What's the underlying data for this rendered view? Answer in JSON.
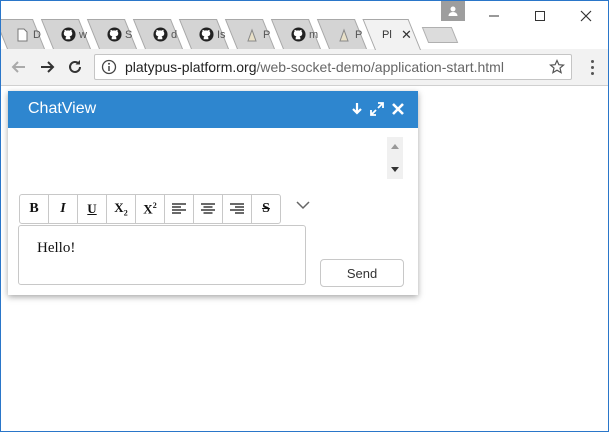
{
  "browser": {
    "tabs": [
      {
        "title": "D",
        "icon": "document-icon"
      },
      {
        "title": "w",
        "icon": "github-icon"
      },
      {
        "title": "S",
        "icon": "github-icon"
      },
      {
        "title": "d",
        "icon": "github-icon"
      },
      {
        "title": "Is",
        "icon": "github-icon"
      },
      {
        "title": "P",
        "icon": "page-icon"
      },
      {
        "title": "m",
        "icon": "github-icon"
      },
      {
        "title": "P",
        "icon": "page-icon"
      },
      {
        "title": "Pl",
        "icon": "none",
        "active": true
      }
    ],
    "url_host": "platypus-platform.org",
    "url_path": "/web-socket-demo/application-start.html",
    "close_glyph": "✕"
  },
  "chat": {
    "title": "ChatView",
    "editor_text": "Hello!",
    "send_label": "Send",
    "accent_color": "#2e86cf",
    "format_buttons": [
      {
        "name": "bold-button",
        "icon": "bold-icon"
      },
      {
        "name": "italic-button",
        "icon": "italic-icon"
      },
      {
        "name": "underline-button",
        "icon": "underline-icon"
      },
      {
        "name": "subscript-button",
        "icon": "subscript-icon"
      },
      {
        "name": "superscript-button",
        "icon": "superscript-icon"
      },
      {
        "name": "align-left-button",
        "icon": "align-left-icon"
      },
      {
        "name": "align-center-button",
        "icon": "align-center-icon"
      },
      {
        "name": "align-right-button",
        "icon": "align-right-icon"
      },
      {
        "name": "strikethrough-button",
        "icon": "strikethrough-icon"
      }
    ]
  }
}
